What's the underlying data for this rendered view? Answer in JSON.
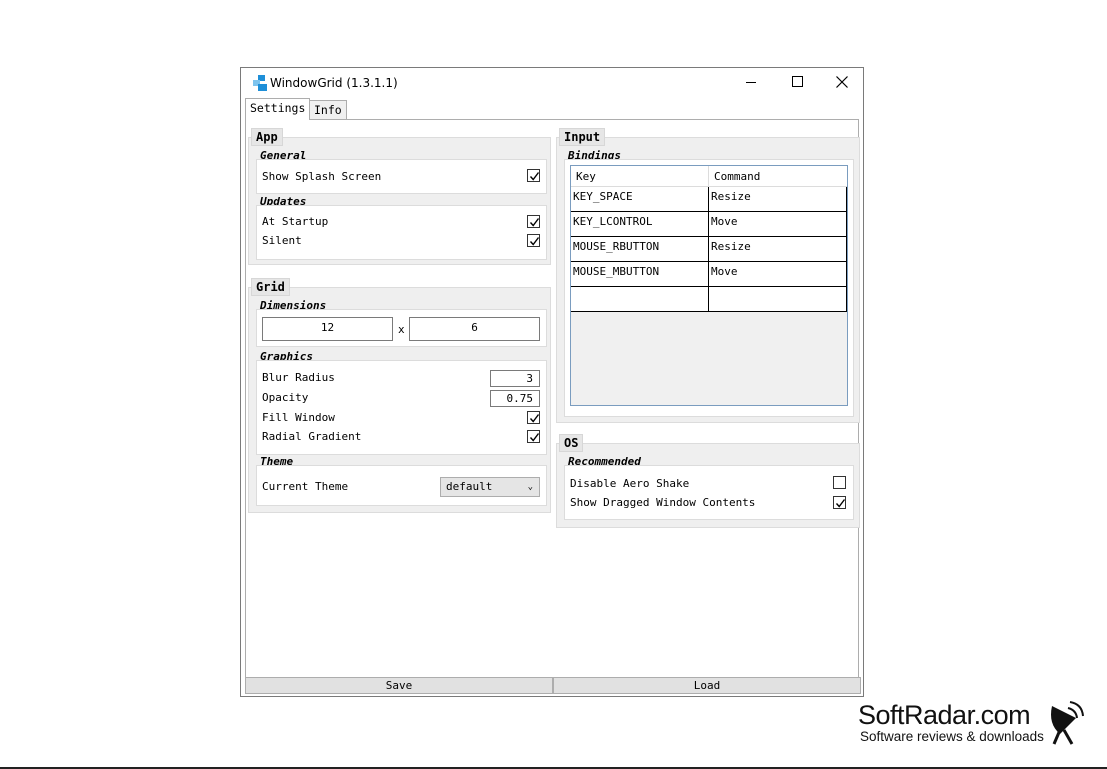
{
  "window": {
    "title": "WindowGrid (1.3.1.1)",
    "icons": {
      "app": "windowgrid-app-icon",
      "minimize": "minimize-icon",
      "maximize": "maximize-icon",
      "close": "close-icon"
    }
  },
  "tabs": [
    {
      "label": "Settings",
      "selected": true
    },
    {
      "label": "Info",
      "selected": false
    }
  ],
  "app_group": {
    "title": "App",
    "general": {
      "title": "General",
      "show_splash": {
        "label": "Show Splash Screen",
        "checked": true
      }
    },
    "updates": {
      "title": "Updates",
      "at_startup": {
        "label": "At Startup",
        "checked": true
      },
      "silent": {
        "label": "Silent",
        "checked": true
      }
    }
  },
  "grid_group": {
    "title": "Grid",
    "dimensions": {
      "title": "Dimensions",
      "width": "12",
      "separator": "x",
      "height": "6"
    },
    "graphics": {
      "title": "Graphics",
      "blur_radius": {
        "label": "Blur Radius",
        "value": "3"
      },
      "opacity": {
        "label": "Opacity",
        "value": "0.75"
      },
      "fill_window": {
        "label": "Fill Window",
        "checked": true
      },
      "radial_gradient": {
        "label": "Radial Gradient",
        "checked": true
      }
    },
    "theme": {
      "title": "Theme",
      "current_label": "Current Theme",
      "current_value": "default"
    }
  },
  "input_group": {
    "title": "Input",
    "bindings": {
      "title": "Bindings",
      "headers": {
        "key": "Key",
        "command": "Command"
      },
      "rows": [
        {
          "key": "KEY_SPACE",
          "command": "Resize"
        },
        {
          "key": "KEY_LCONTROL",
          "command": "Move"
        },
        {
          "key": "MOUSE_RBUTTON",
          "command": "Resize"
        },
        {
          "key": "MOUSE_MBUTTON",
          "command": "Move"
        },
        {
          "key": "",
          "command": ""
        }
      ]
    }
  },
  "os_group": {
    "title": "OS",
    "recommended": {
      "title": "Recommended",
      "disable_aero_shake": {
        "label": "Disable Aero Shake",
        "checked": false
      },
      "show_dragged": {
        "label": "Show Dragged Window Contents",
        "checked": true
      }
    }
  },
  "buttons": {
    "save": "Save",
    "load": "Load"
  },
  "watermark": {
    "name": "SoftRadar.com",
    "tagline": "Software reviews & downloads",
    "logo_icon": "satellite-dish-icon"
  },
  "colors": {
    "group_bg": "#efefef",
    "button_bg": "#e1e1e1",
    "table_border": "#7a9cbf"
  }
}
